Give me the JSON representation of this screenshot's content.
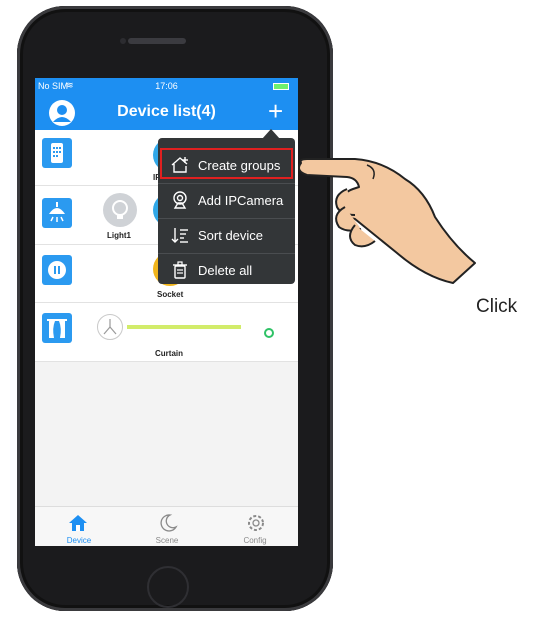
{
  "status_bar": {
    "carrier": "No SIM",
    "time": "17:06"
  },
  "navbar": {
    "title": "Device list(4)"
  },
  "devices": [
    {
      "label": "IP",
      "icon": "remote-icon"
    },
    {
      "label": "Light1",
      "icon": "ceiling-light-icon"
    },
    {
      "label": "Socket",
      "icon": "socket-icon"
    },
    {
      "label": "Curtain",
      "icon": "curtain-icon"
    }
  ],
  "menu": {
    "items": [
      {
        "label": "Create groups",
        "icon": "house-plus-icon"
      },
      {
        "label": "Add IPCamera",
        "icon": "camera-icon"
      },
      {
        "label": "Sort device",
        "icon": "sort-icon"
      },
      {
        "label": "Delete all",
        "icon": "trash-icon"
      }
    ]
  },
  "tabs": [
    {
      "label": "Device",
      "icon": "home-icon",
      "active": true
    },
    {
      "label": "Scene",
      "icon": "moon-icon",
      "active": false
    },
    {
      "label": "Config",
      "icon": "gear-icon",
      "active": false
    }
  ],
  "annotation": {
    "label": "Click"
  },
  "colors": {
    "accent": "#1d8ff2",
    "highlight": "#e02020",
    "menu_bg": "#333638"
  }
}
